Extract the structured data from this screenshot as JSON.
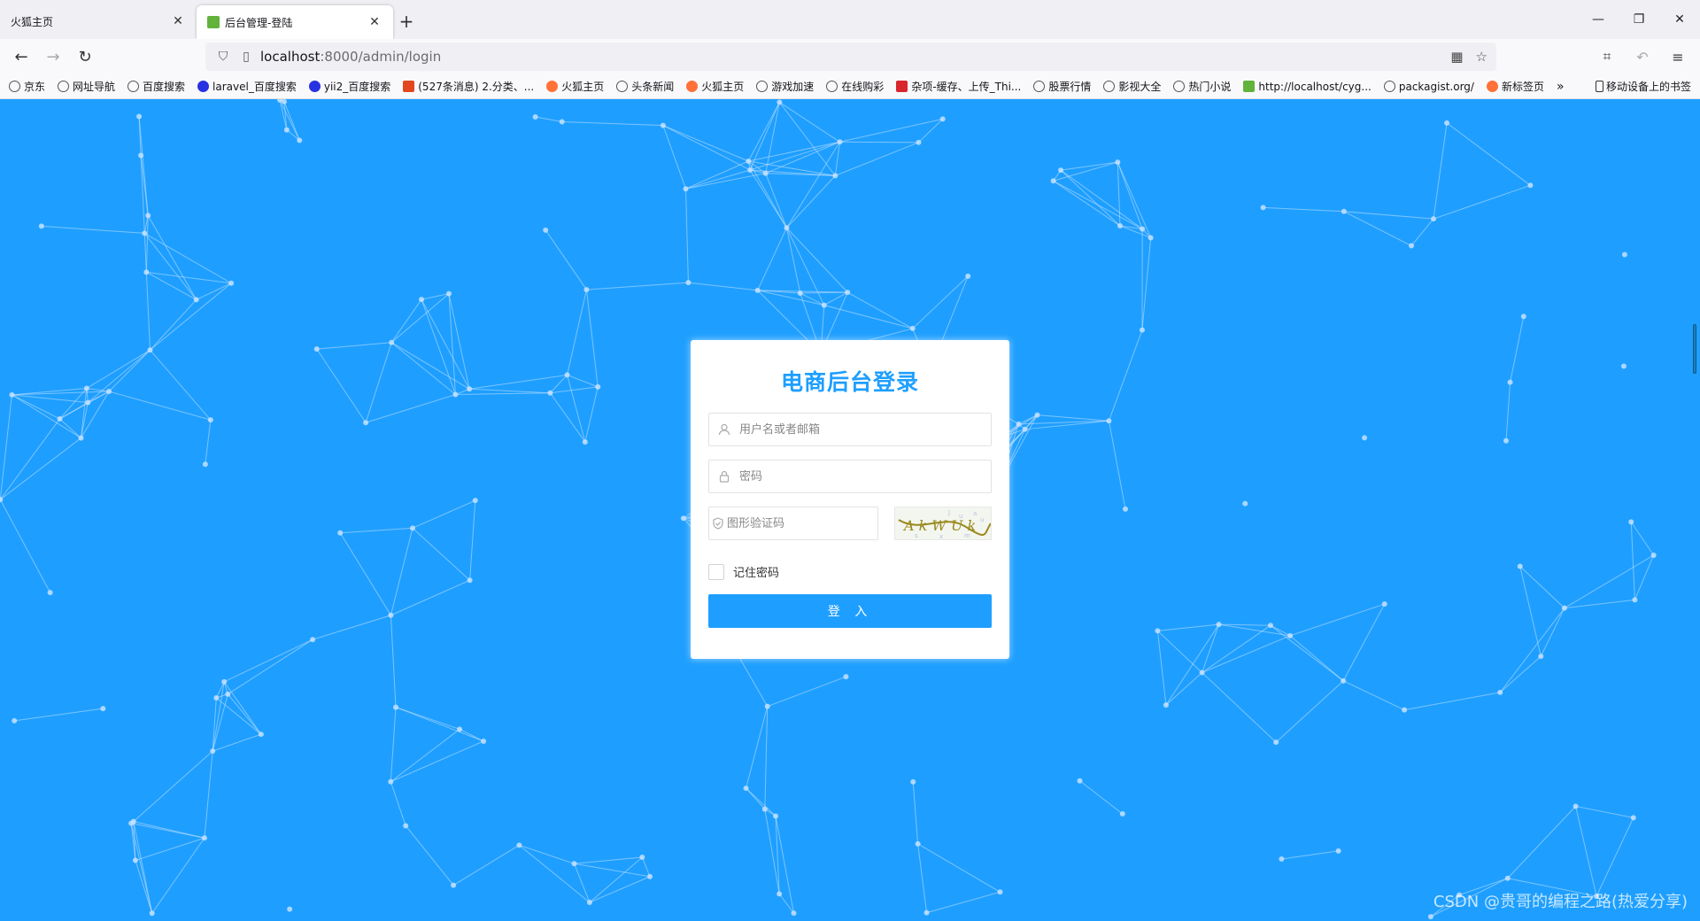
{
  "browser": {
    "tabs": [
      {
        "label": "火狐主页",
        "active": false
      },
      {
        "label": "后台管理-登陆",
        "active": true
      }
    ],
    "new_tab_label": "+",
    "url_host": "localhost",
    "url_path": ":8000/admin/login",
    "bookmarks": [
      {
        "label": "京东",
        "icon": "globe-icon"
      },
      {
        "label": "网址导航",
        "icon": "globe-icon"
      },
      {
        "label": "百度搜索",
        "icon": "globe-icon"
      },
      {
        "label": "laravel_百度搜索",
        "icon": "baidu-paw-icon"
      },
      {
        "label": "yii2_百度搜索",
        "icon": "baidu-paw-icon"
      },
      {
        "label": "(527条消息) 2.分类、...",
        "icon": "csdn-icon"
      },
      {
        "label": "火狐主页",
        "icon": "firefox-icon"
      },
      {
        "label": "头条新闻",
        "icon": "globe-icon"
      },
      {
        "label": "火狐主页",
        "icon": "firefox-icon"
      },
      {
        "label": "游戏加速",
        "icon": "globe-icon"
      },
      {
        "label": "在线购彩",
        "icon": "globe-icon"
      },
      {
        "label": "杂项-缓存、上传_Thi...",
        "icon": "51-icon"
      },
      {
        "label": "股票行情",
        "icon": "globe-icon"
      },
      {
        "label": "影视大全",
        "icon": "globe-icon"
      },
      {
        "label": "热门小说",
        "icon": "globe-icon"
      },
      {
        "label": "http://localhost/cyg...",
        "icon": "leaf-icon"
      },
      {
        "label": "packagist.org/",
        "icon": "globe-icon"
      },
      {
        "label": "新标签页",
        "icon": "firefox-icon"
      }
    ],
    "bookmarks_more": "»",
    "mobile_bookmarks": "移动设备上的书签"
  },
  "login": {
    "title": "电商后台登录",
    "username_placeholder": "用户名或者邮箱",
    "password_placeholder": "密码",
    "captcha_placeholder": "图形验证码",
    "captcha_text": "A k W U k",
    "remember_label": "记住密码",
    "submit_label": "登 入"
  },
  "watermark": "CSDN @贵哥的编程之路(热爱分享)",
  "colors": {
    "background": "#1e9fff",
    "accent": "#1e9fff",
    "captcha_ink": "#9a8a1e"
  }
}
